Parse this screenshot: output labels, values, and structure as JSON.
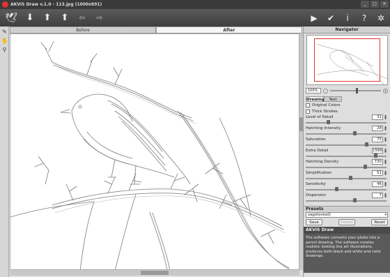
{
  "window": {
    "title": "AKVIS Draw v.1.0 - 113.jpg (1000x691)",
    "controls": [
      "_",
      "□",
      "✕"
    ]
  },
  "toolbar": {
    "left_icons": [
      "logo-bird-icon",
      "open-icon",
      "save-icon",
      "print-icon",
      "undo-icon",
      "redo-icon"
    ],
    "right_icons": [
      "run-icon",
      "apply-icon",
      "info-icon",
      "help-icon",
      "settings-icon"
    ]
  },
  "tabs": {
    "before": "Before",
    "after": "After"
  },
  "navigator": {
    "title": "Navigator",
    "zoom": "100%",
    "zoom_out": "-",
    "zoom_in": "+"
  },
  "settings_tabs": {
    "drawing": "Drawing",
    "text": "Text"
  },
  "options": {
    "original_colors": "Original Colors",
    "thick_strokes": "Thick Strokes"
  },
  "params": [
    {
      "label": "Level of Detail",
      "value": "31",
      "pos": 0.28
    },
    {
      "label": "Hatching Intensity",
      "value": "28",
      "pos": 0.6
    },
    {
      "label": "Saturation",
      "value": "75",
      "pos": 0.75
    },
    {
      "label": "Extra Detail",
      "value": "1586",
      "pos": 0.86
    },
    {
      "label": "Hatching Density",
      "value": "730",
      "pos": 0.73
    },
    {
      "label": "Simplification",
      "value": "51",
      "pos": 0.55
    },
    {
      "label": "Sensitivity",
      "value": "46",
      "pos": 0.38
    },
    {
      "label": "Dispersion",
      "value": "7",
      "pos": 0.6
    }
  ],
  "presets": {
    "title": "Presets",
    "selected": "zagotovkaQ",
    "save": "Save",
    "delete": "Delete",
    "reset": "Reset"
  },
  "about": {
    "title": "AKVIS Draw",
    "text": "The software converts your photo into a pencil drawing. The software creates realistic looking line art illustrations, produces both black and white and color drawings."
  }
}
